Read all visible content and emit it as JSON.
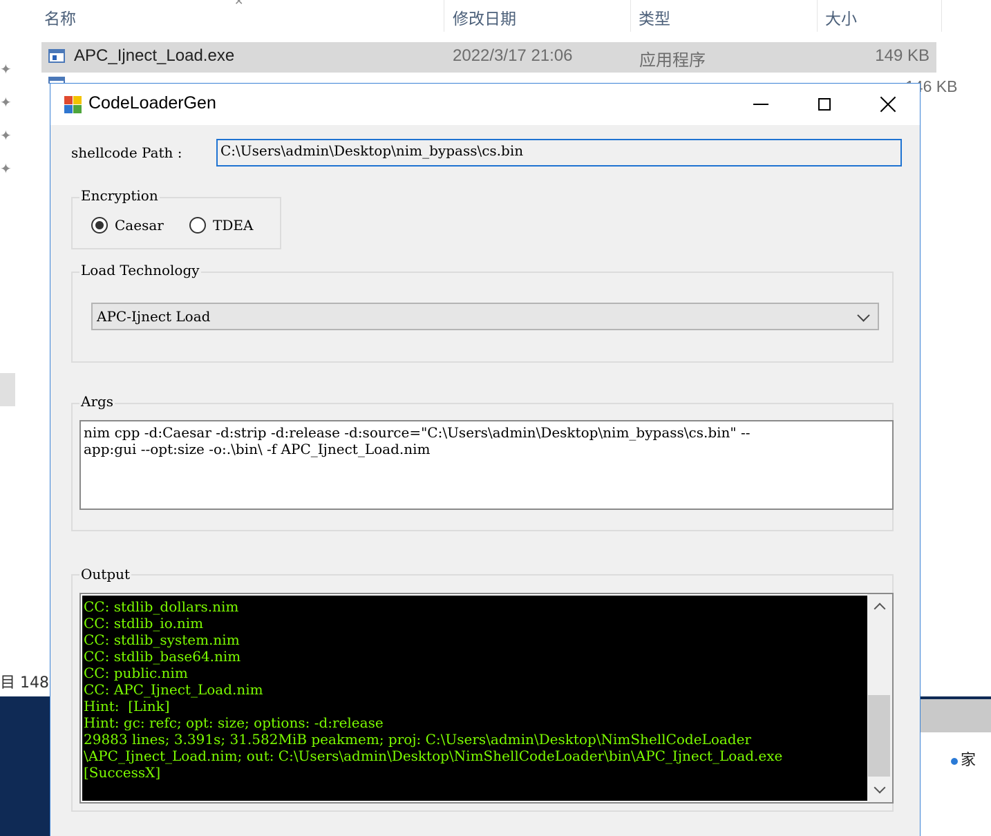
{
  "explorer": {
    "columns": {
      "name": "名称",
      "modified": "修改日期",
      "type": "类型",
      "size": "大小"
    },
    "files": [
      {
        "name": "APC_Ijnect_Load.exe",
        "modified": "2022/3/17 21:06",
        "type": "应用程序",
        "size": "149 KB"
      }
    ],
    "partial_size": "146 KB",
    "status_text": "目  148",
    "tray_text": "家"
  },
  "window": {
    "title": "CodeLoaderGen",
    "shellcode_label": "shellcode Path :",
    "shellcode_path": "C:\\Users\\admin\\Desktop\\nim_bypass\\cs.bin",
    "encryption": {
      "title": "Encryption",
      "options": [
        "Caesar",
        "TDEA"
      ],
      "selected": "Caesar"
    },
    "load_technology": {
      "title": "Load Technology",
      "selected": "APC-Ijnect Load"
    },
    "args": {
      "title": "Args",
      "lines": [
        "nim cpp -d:Caesar -d:strip -d:release -d:source=\"C:\\Users\\admin\\Desktop\\nim_bypass\\cs.bin\" --",
        "app:gui --opt:size -o:.\\bin\\ -f APC_Ijnect_Load.nim"
      ]
    },
    "output": {
      "title": "Output",
      "lines": [
        "CC: stdlib_dollars.nim",
        "CC: stdlib_io.nim",
        "CC: stdlib_system.nim",
        "CC: stdlib_base64.nim",
        "CC: public.nim",
        "CC: APC_Ijnect_Load.nim",
        "Hint:  [Link]",
        "Hint: gc: refc; opt: size; options: -d:release",
        "29883 lines; 3.391s; 31.582MiB peakmem; proj: C:\\Users\\admin\\Desktop\\NimShellCodeLoader",
        "\\APC_Ijnect_Load.nim; out: C:\\Users\\admin\\Desktop\\NimShellCodeLoader\\bin\\APC_Ijnect_Load.exe",
        "[SuccessX]"
      ],
      "text_color": "#7cfc00",
      "background": "#000000"
    }
  }
}
